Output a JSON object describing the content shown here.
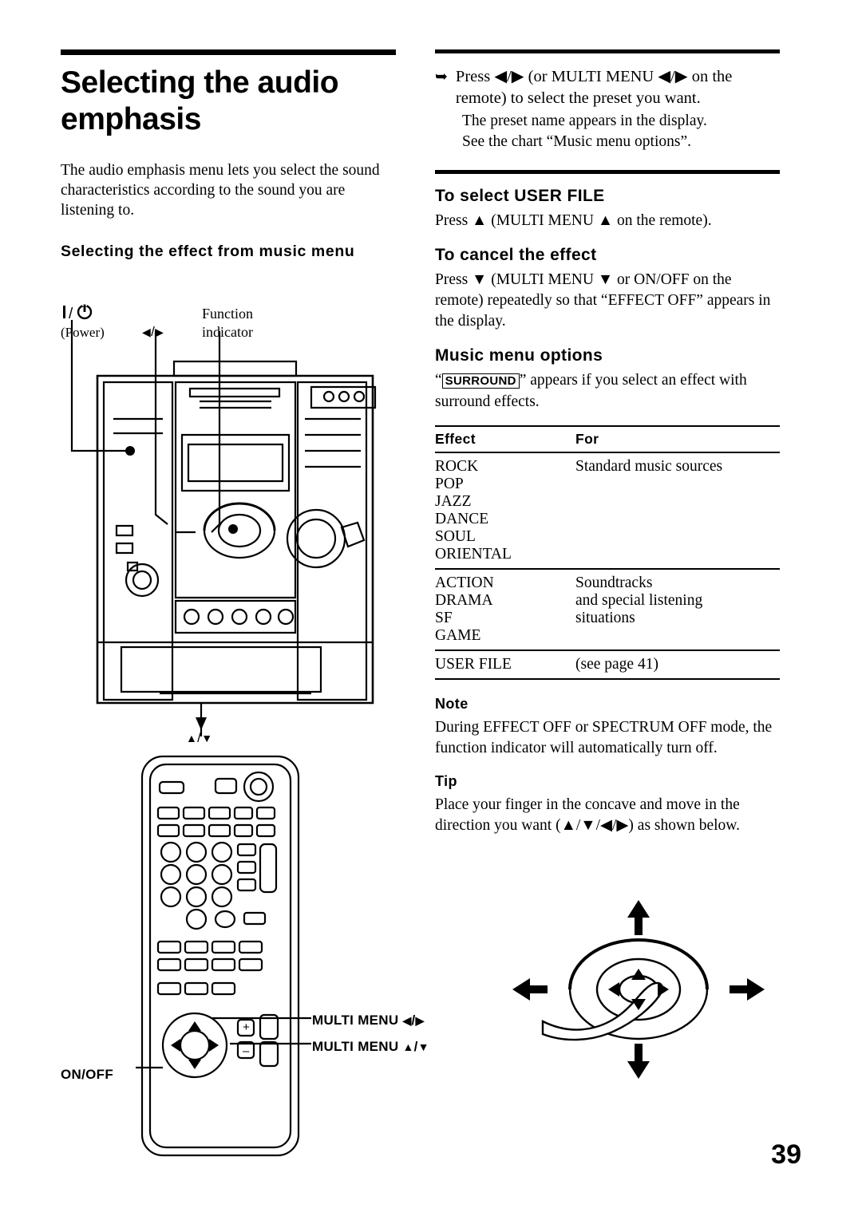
{
  "page_number": "39",
  "left": {
    "title": "Selecting the audio emphasis",
    "intro": "The audio emphasis menu lets you select the sound characteristics according to the sound you are listening to.",
    "subheading": "Selecting the effect from music menu",
    "callouts": {
      "power_symbol": "?/1",
      "power_label": "(Power)",
      "left_right": "?/?",
      "function_line1": "Function",
      "function_line2": "indicator",
      "up_down": "?/?",
      "multi_menu_lr": "MULTI MENU ?/?",
      "multi_menu_ud": "MULTI MENU ?/?",
      "on_off": "ON/OFF"
    }
  },
  "right": {
    "step": {
      "text": "Press ?/? (or MULTI MENU ?/? on the remote) to select the preset you want.",
      "sub1": "The preset name appears in the display.",
      "sub2": "See the chart “Music menu options”."
    },
    "select_user_file": {
      "heading": "To select USER FILE",
      "body": "Press ? (MULTI MENU ? on the remote)."
    },
    "cancel_effect": {
      "heading": "To cancel the effect",
      "body": "Press ? (MULTI MENU ? or ON/OFF on the remote) repeatedly so that “EFFECT OFF” appears in the display."
    },
    "music_menu_options": {
      "heading": "Music menu options",
      "intro_prefix": "“",
      "intro_boxed": "SURROUND",
      "intro_suffix": "” appears if you select an effect with surround effects.",
      "columns": [
        "Effect",
        "For"
      ],
      "groups": [
        {
          "effects": [
            "ROCK",
            "POP",
            "JAZZ",
            "DANCE",
            "SOUL",
            "ORIENTAL"
          ],
          "for": [
            "Standard music sources"
          ]
        },
        {
          "effects": [
            "ACTION",
            "DRAMA",
            "SF",
            "GAME"
          ],
          "for": [
            "Soundtracks",
            "and special listening",
            "situations"
          ]
        },
        {
          "effects": [
            "USER FILE"
          ],
          "for": [
            "(see page 41)"
          ]
        }
      ]
    },
    "note": {
      "heading": "Note",
      "body": "During EFFECT OFF or SPECTRUM OFF mode, the function indicator will automatically turn off."
    },
    "tip": {
      "heading": "Tip",
      "body": "Place your finger in the concave and move in the direction you want (?/?/?/?) as shown below."
    }
  }
}
